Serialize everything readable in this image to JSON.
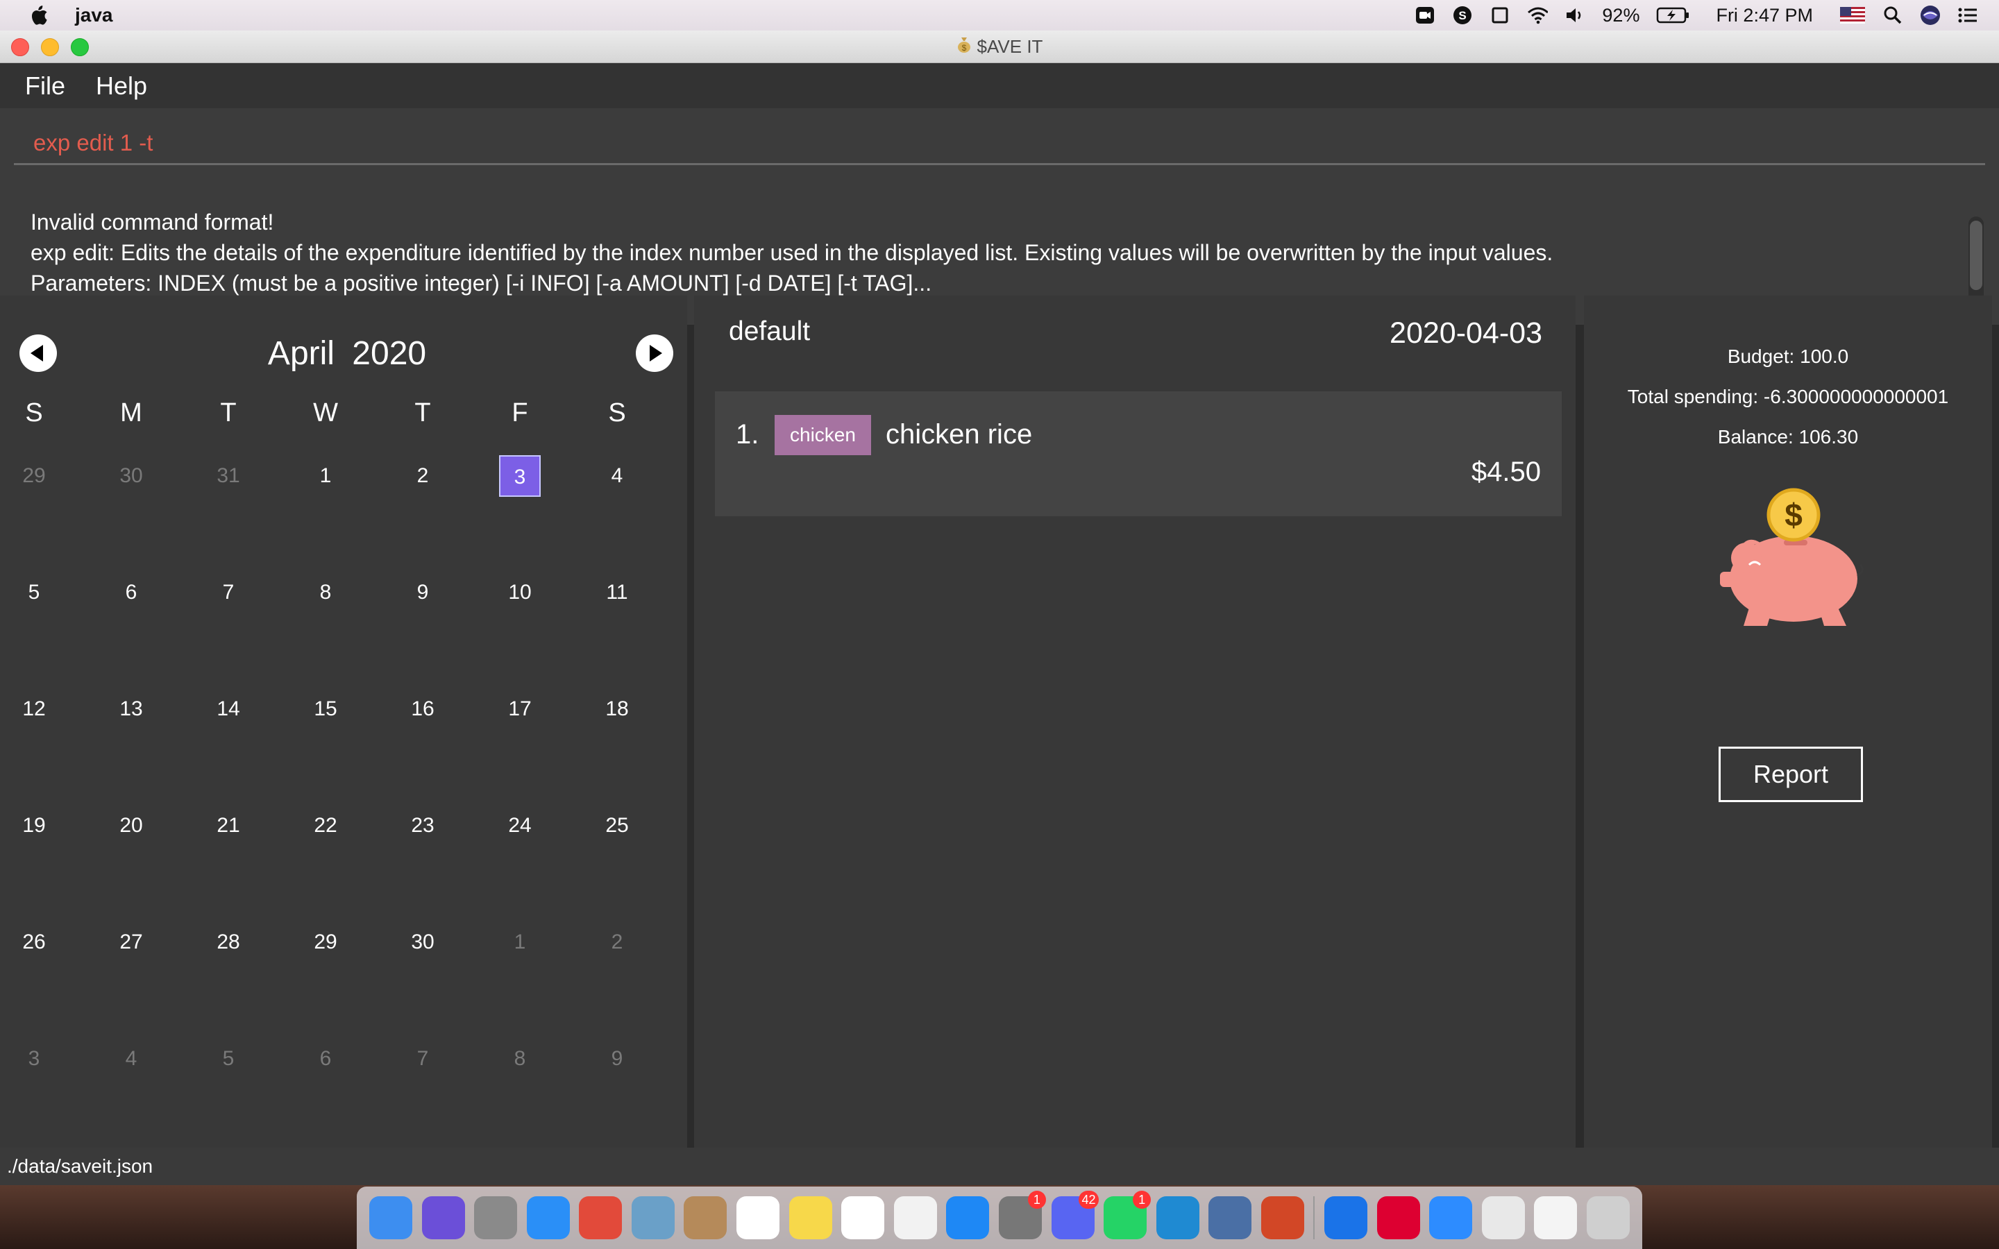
{
  "menubar": {
    "app_name": "java",
    "battery": "92%",
    "clock": "Fri 2:47 PM"
  },
  "window": {
    "title": "$AVE IT",
    "menu": [
      "File",
      "Help"
    ]
  },
  "command": {
    "value": "exp edit 1 -t"
  },
  "result": {
    "lines": [
      "Invalid command format!",
      "exp edit: Edits the details of the expenditure identified by the index number used in the displayed list. Existing values will be overwritten by the input values.",
      "Parameters: INDEX (must be a positive integer) [-i INFO] [-a AMOUNT] [-d DATE] [-t TAG]..."
    ]
  },
  "calendar": {
    "month": "April",
    "year": "2020",
    "weekdays": [
      "S",
      "M",
      "T",
      "W",
      "T",
      "F",
      "S"
    ],
    "weeks": [
      [
        {
          "d": "29",
          "o": true
        },
        {
          "d": "30",
          "o": true
        },
        {
          "d": "31",
          "o": true
        },
        {
          "d": "1"
        },
        {
          "d": "2"
        },
        {
          "d": "3",
          "sel": true
        },
        {
          "d": "4"
        }
      ],
      [
        {
          "d": "5"
        },
        {
          "d": "6"
        },
        {
          "d": "7"
        },
        {
          "d": "8"
        },
        {
          "d": "9"
        },
        {
          "d": "10"
        },
        {
          "d": "11"
        }
      ],
      [
        {
          "d": "12"
        },
        {
          "d": "13"
        },
        {
          "d": "14"
        },
        {
          "d": "15"
        },
        {
          "d": "16"
        },
        {
          "d": "17"
        },
        {
          "d": "18"
        }
      ],
      [
        {
          "d": "19"
        },
        {
          "d": "20"
        },
        {
          "d": "21"
        },
        {
          "d": "22"
        },
        {
          "d": "23"
        },
        {
          "d": "24"
        },
        {
          "d": "25"
        }
      ],
      [
        {
          "d": "26"
        },
        {
          "d": "27"
        },
        {
          "d": "28"
        },
        {
          "d": "29"
        },
        {
          "d": "30"
        },
        {
          "d": "1",
          "o": true
        },
        {
          "d": "2",
          "o": true
        }
      ],
      [
        {
          "d": "3",
          "o": true
        },
        {
          "d": "4",
          "o": true
        },
        {
          "d": "5",
          "o": true
        },
        {
          "d": "6",
          "o": true
        },
        {
          "d": "7",
          "o": true
        },
        {
          "d": "8",
          "o": true
        },
        {
          "d": "9",
          "o": true
        }
      ]
    ],
    "selected_color": "#7c5fe6"
  },
  "expenditures": {
    "account": "default",
    "date": "2020-04-03",
    "items": [
      {
        "index": "1.",
        "tag": "chicken",
        "info": "chicken rice",
        "amount": "$4.50"
      }
    ]
  },
  "summary": {
    "budget": "Budget: 100.0",
    "total_spending": "Total spending: -6.300000000000001",
    "balance": "Balance: 106.30",
    "report_label": "Report"
  },
  "status": {
    "path": "./data/saveit.json"
  },
  "dock": {
    "icons": [
      {
        "name": "finder-icon",
        "color": "#3d8ef0"
      },
      {
        "name": "siri-icon",
        "color": "#6b4fd8"
      },
      {
        "name": "launchpad-icon",
        "color": "#8a8a8a"
      },
      {
        "name": "safari-icon",
        "color": "#2a8ff7"
      },
      {
        "name": "chrome-icon",
        "color": "#e24a3a"
      },
      {
        "name": "preview-icon",
        "color": "#6aa0c8"
      },
      {
        "name": "contacts-icon",
        "color": "#b58a5a"
      },
      {
        "name": "calendar-icon",
        "color": "#ffffff"
      },
      {
        "name": "notes-icon",
        "color": "#f7d84a"
      },
      {
        "name": "reminders-icon",
        "color": "#ffffff"
      },
      {
        "name": "music-icon",
        "color": "#f2f2f2"
      },
      {
        "name": "app-store-icon",
        "color": "#1e88f5"
      },
      {
        "name": "system-preferences-icon",
        "color": "#777777",
        "badge": "1"
      },
      {
        "name": "discord-icon",
        "color": "#5865f2",
        "badge": "42"
      },
      {
        "name": "whatsapp-icon",
        "color": "#25d366",
        "badge": "1"
      },
      {
        "name": "vscode-icon",
        "color": "#1f8ad2"
      },
      {
        "name": "virtualbox-icon",
        "color": "#4a6fa5"
      },
      {
        "name": "powerpoint-icon",
        "color": "#d24726"
      },
      {
        "name": "maps-pin-icon",
        "color": "#1a73e8"
      },
      {
        "name": "angular-icon",
        "color": "#dd0031"
      },
      {
        "name": "zoom-icon",
        "color": "#2d8cff"
      },
      {
        "name": "java-coffee-icon",
        "color": "#e8e8e8"
      },
      {
        "name": "downloads-calendar-icon",
        "color": "#f4f4f4"
      },
      {
        "name": "trash-icon",
        "color": "#cfcfcf"
      }
    ]
  }
}
